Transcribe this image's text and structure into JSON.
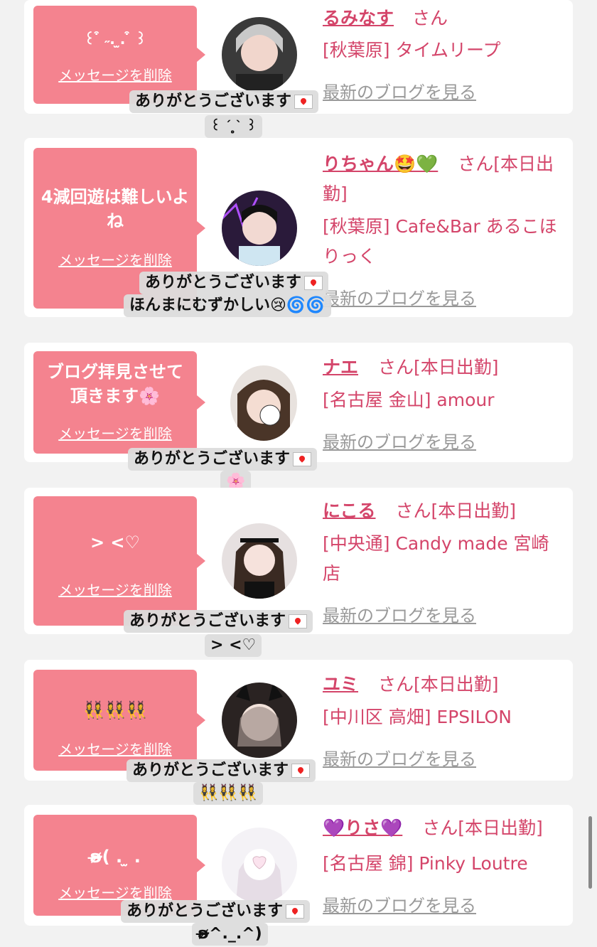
{
  "common": {
    "delete_label": "メッセージを削除",
    "blog_label": "最新のブログを見る",
    "san": "さん",
    "thanks": "ありがとうございます"
  },
  "cards": [
    {
      "message": "꒰ ͒ ˶. ̫. ͒ ꒱",
      "name": "るみなす",
      "suffix": "さん",
      "shop": "[秋葉原] タイムリープ",
      "reply": "꒰ ˊ ̥̥̥̥̥̥̥̥̥̥̥̥̥̥̥̥̥ˋ ꒱"
    },
    {
      "message": "4減回遊は難しいよね",
      "name": "りちゃん🤩💚",
      "suffix": "さん[本日出勤]",
      "shop": "[秋葉原] Cafe&Bar あるこほりっく",
      "reply": "ほんまにむずかしい😢🌀🌀"
    },
    {
      "message": "ブログ拝見させて頂きます🌸",
      "name": "ナエ",
      "suffix": "さん[本日出勤]",
      "shop": "[名古屋 金山] amour",
      "reply": "🌸"
    },
    {
      "message": "> <♡",
      "name": "にこる",
      "suffix": "さん[本日出勤]",
      "shop": "[中央通] Candy made 宮崎店",
      "reply": "> <♡"
    },
    {
      "message": "👯‍♀️👯‍♀️👯‍♀️",
      "name": "ユミ",
      "suffix": "さん[本日出勤]",
      "shop": "[中川区 高畑] EPSILON",
      "reply": "👯‍♀️👯‍♀️👯‍♀️"
    },
    {
      "message": "ʚ̴̶̷( . ̫ . ",
      "name": "💜りさ💜",
      "suffix": "さん[本日出勤]",
      "shop": "[名古屋 錦] Pinky Loutre",
      "reply": "ʚ̴̶̷^._.^)"
    }
  ]
}
